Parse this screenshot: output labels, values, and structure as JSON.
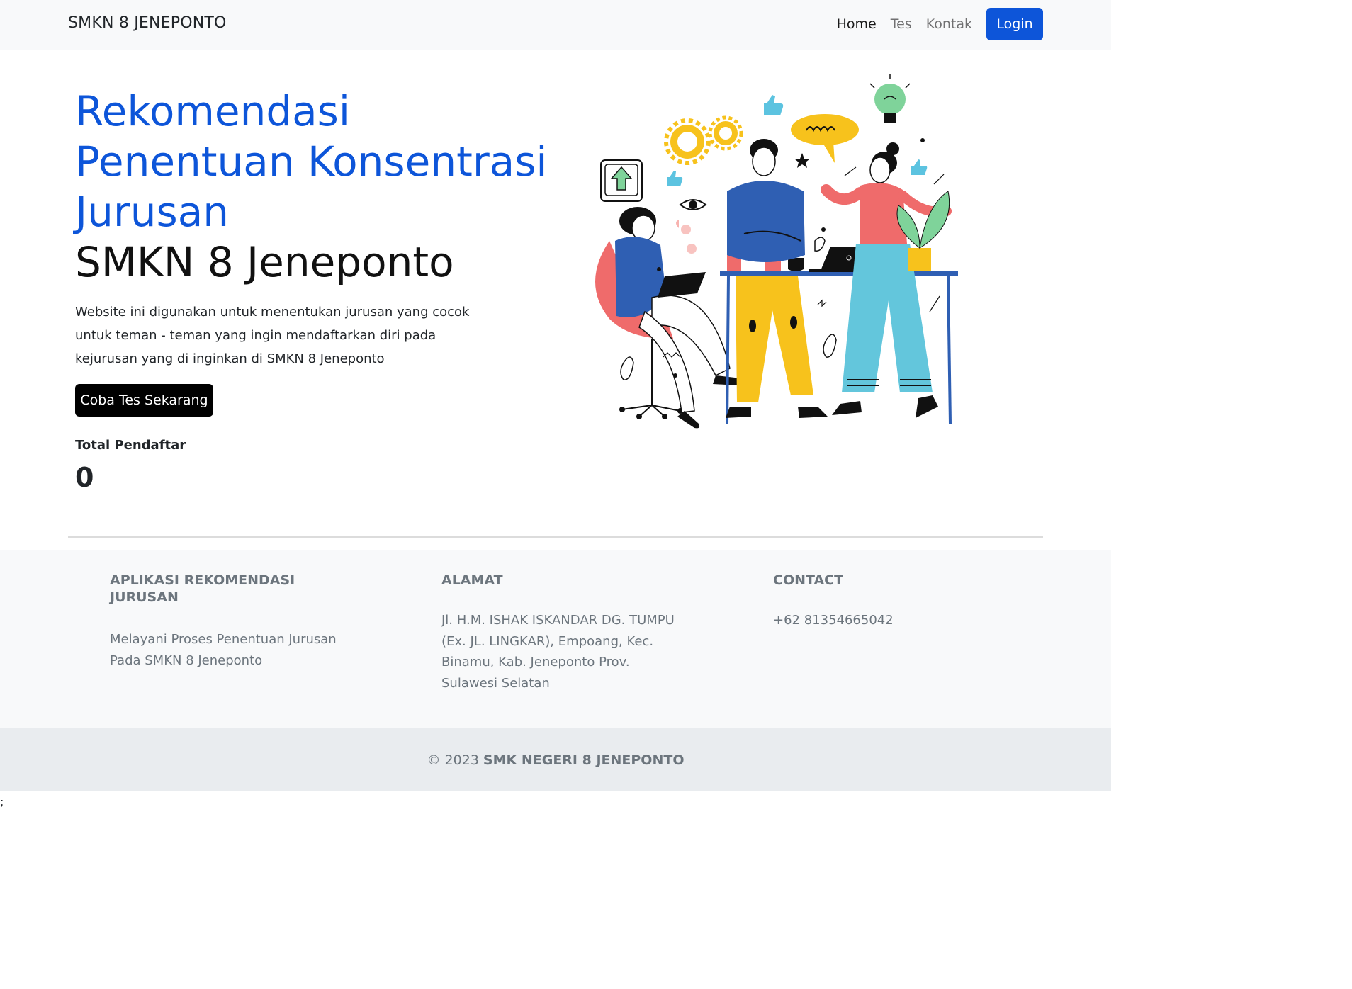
{
  "navbar": {
    "brand": "SMKN 8 JENEPONTO",
    "links": [
      {
        "label": "Home",
        "active": true
      },
      {
        "label": "Tes",
        "active": false
      },
      {
        "label": "Kontak",
        "active": false
      }
    ],
    "login_label": "Login"
  },
  "hero": {
    "title_lines": [
      "Rekomendasi",
      "Penentuan Konsentrasi",
      "Jurusan"
    ],
    "subtitle": "SMKN 8 Jeneponto",
    "description": "Website ini digunakan untuk menentukan jurusan yang cocok untuk teman - teman yang ingin mendaftarkan diri pada kejurusan yang di inginkan di SMKN 8 Jeneponto",
    "cta_label": "Coba Tes Sekarang",
    "stat_label": "Total Pendaftar",
    "stat_value": "0"
  },
  "footer": {
    "col1_title": "APLIKASI REKOMENDASI JURUSAN",
    "col1_text": "Melayani Proses Penentuan Jurusan Pada SMKN 8 Jeneponto",
    "col2_title": "ALAMAT",
    "col2_text": "Jl. H.M. ISHAK ISKANDAR DG. TUMPU (Ex. JL. LINGKAR), Empoang, Kec. Binamu, Kab. Jeneponto Prov. Sulawesi Selatan",
    "col3_title": "CONTACT",
    "col3_text": "+62 81354665042"
  },
  "copyright": {
    "prefix": "© 2023",
    "org": "SMK NEGERI 8 JENEPONTO"
  },
  "stray_text": ";",
  "colors": {
    "primary": "#0d55d9",
    "navbar_bg": "#f8f9fa",
    "footer_bg": "#f8f9fa",
    "copyright_bg": "#e9ecef",
    "muted_text": "#6c757d"
  },
  "illustration": {
    "icons": [
      "gear-icon",
      "lightbulb-icon",
      "thumbs-up-icon",
      "speech-bubble-icon",
      "upload-arrow-icon",
      "eye-icon",
      "laptop-icon",
      "tablet-icon",
      "plant-icon"
    ]
  }
}
